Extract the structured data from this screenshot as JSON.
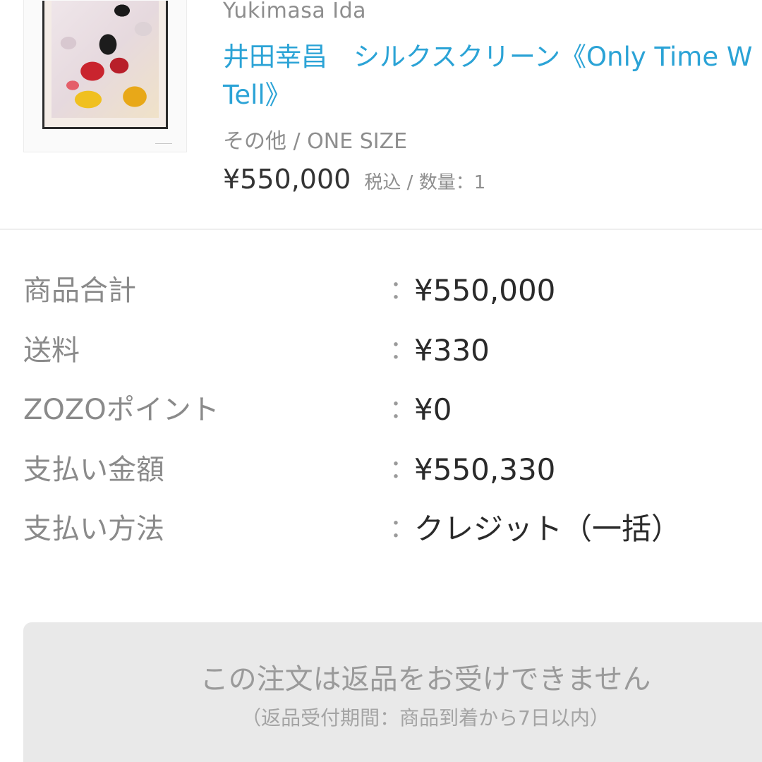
{
  "product": {
    "brand": "Yukimasa Ida",
    "title_line1": "井田幸昌　シルクスクリーン《Only Time W",
    "title_line2": "Tell》",
    "variant": "その他 / ONE SIZE",
    "price": "¥550,000",
    "price_note": "税込 / 数量：1",
    "thumbnail": "artwork-thumbnail"
  },
  "summary": {
    "separator": "：",
    "rows": [
      {
        "label": "商品合計",
        "value": "¥550,000"
      },
      {
        "label": "送料",
        "value": "¥330"
      },
      {
        "label": "ZOZOポイント",
        "value": "¥0"
      },
      {
        "label": "支払い金額",
        "value": "¥550,330"
      },
      {
        "label": "支払い方法",
        "value": "クレジット（一括）"
      }
    ]
  },
  "notice": {
    "title": "この注文は返品をお受けできません",
    "subtitle": "（返品受付期間：商品到着から7日以内）"
  },
  "colors": {
    "link": "#2ba3d6",
    "muted_text": "#8e8e8e",
    "body_text": "#2a2a2a",
    "notice_bg": "#e9e9e9"
  }
}
